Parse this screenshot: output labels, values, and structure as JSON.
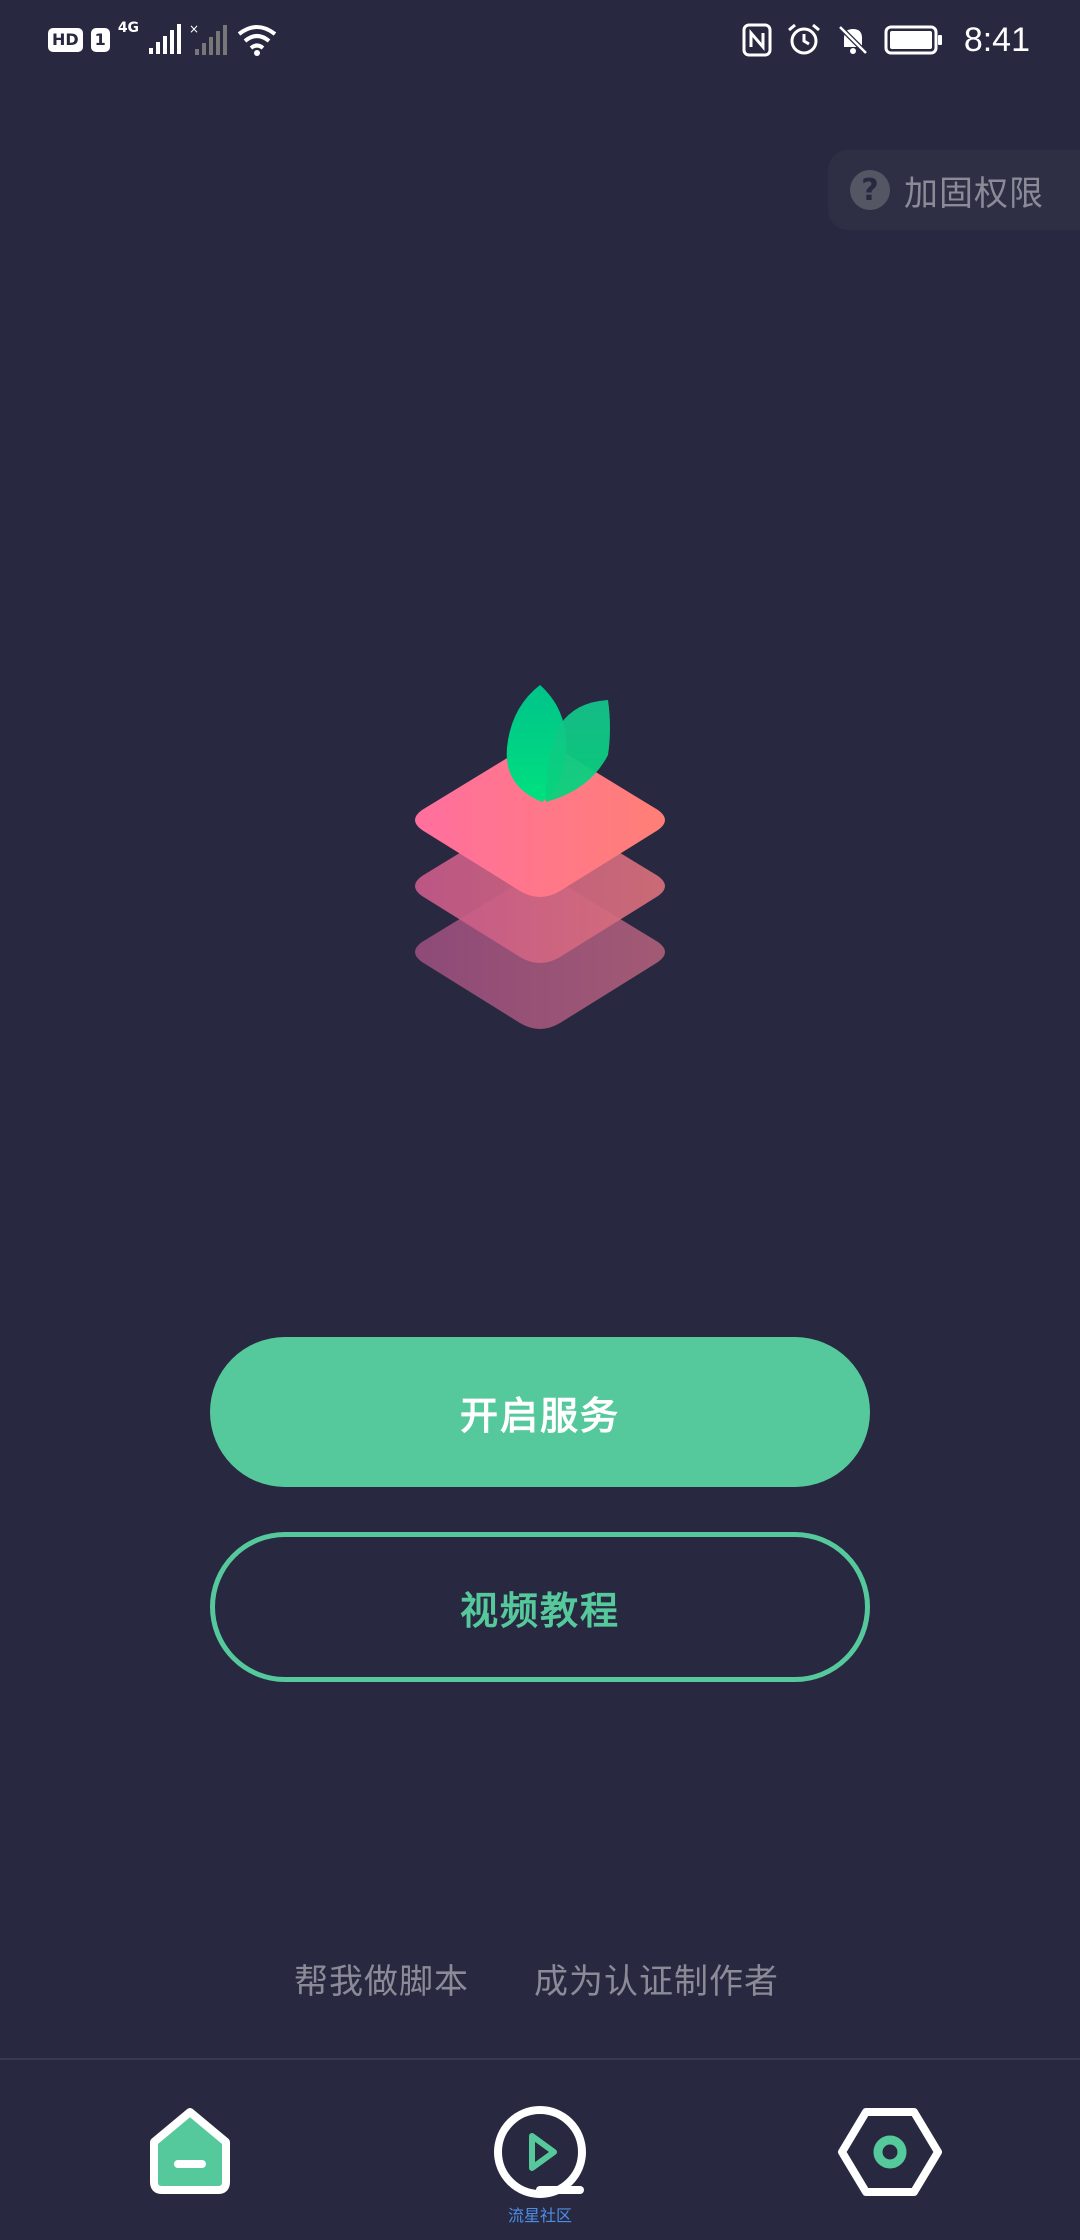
{
  "status_bar": {
    "hd_label": "HD",
    "sim_label": "1",
    "network_label": "4G",
    "time": "8:41"
  },
  "permission": {
    "label": "加固权限",
    "icon": "help-icon"
  },
  "main": {
    "primary_button": "开启服务",
    "secondary_button": "视频教程"
  },
  "links": {
    "script_help": "帮我做脚本",
    "become_author": "成为认证制作者"
  },
  "bottom_nav": {
    "items": [
      {
        "icon": "home-icon",
        "label": ""
      },
      {
        "icon": "play-icon",
        "label": "流星社区"
      },
      {
        "icon": "settings-icon",
        "label": ""
      }
    ]
  },
  "colors": {
    "background": "#282940",
    "accent": "#55c99b",
    "muted_text": "#8a8b97",
    "nav_label": "#4e8ee8"
  }
}
